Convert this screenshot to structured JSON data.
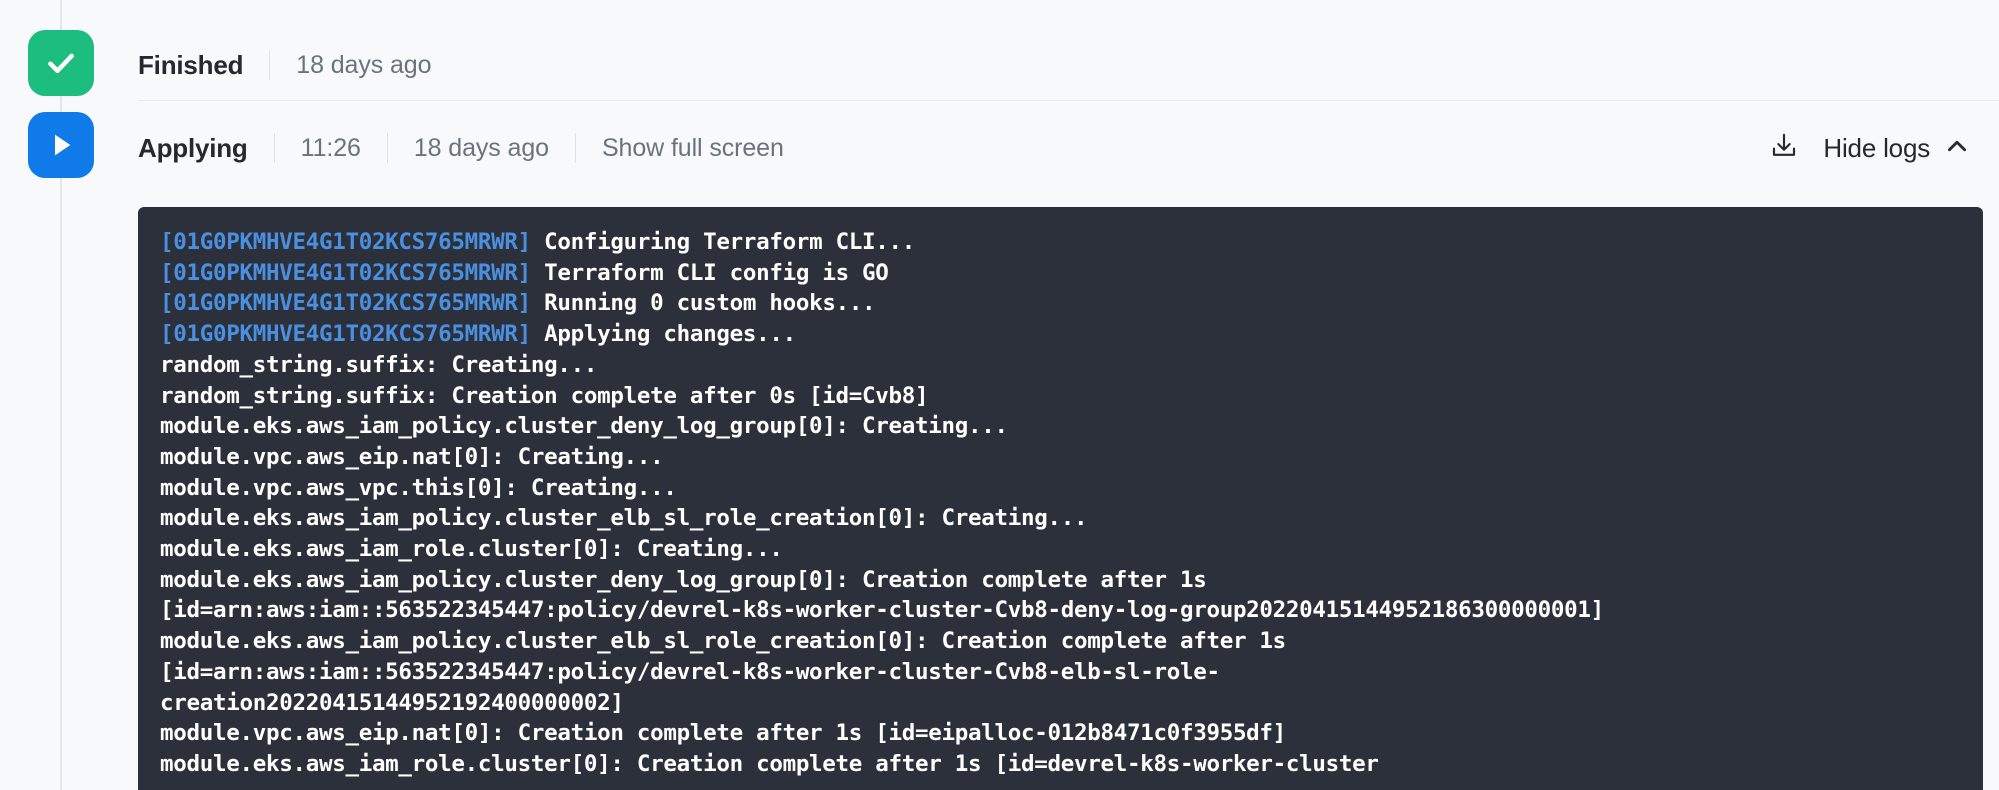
{
  "theme": {
    "page_bg": "#f7f9fa",
    "success_color": "#1cbd7f",
    "running_color": "#0f7ae8",
    "log_bg": "#2b303b",
    "log_text": "#ffffff",
    "log_id_color": "#4a8fe0",
    "muted_text": "#6a737d",
    "title_text": "#24292e"
  },
  "steps": [
    {
      "id": "finished",
      "status_icon": "check-icon",
      "title": "Finished",
      "time": null,
      "relative_time": "18 days ago"
    },
    {
      "id": "applying",
      "status_icon": "play-icon",
      "title": "Applying",
      "time": "11:26",
      "relative_time": "18 days ago",
      "full_screen_label": "Show full screen",
      "download_icon": "download-icon",
      "hide_logs_label": "Hide logs",
      "chevron_icon": "chevron-up-icon"
    }
  ],
  "log": {
    "run_id": "01G0PKMHVE4G1T02KCS765MRWR",
    "lines": [
      {
        "id": "01G0PKMHVE4G1T02KCS765MRWR",
        "text": " Configuring Terraform CLI..."
      },
      {
        "id": "01G0PKMHVE4G1T02KCS765MRWR",
        "text": " Terraform CLI config is GO"
      },
      {
        "id": "01G0PKMHVE4G1T02KCS765MRWR",
        "text": " Running 0 custom hooks..."
      },
      {
        "id": "01G0PKMHVE4G1T02KCS765MRWR",
        "text": " Applying changes..."
      },
      {
        "id": null,
        "text": "random_string.suffix: Creating..."
      },
      {
        "id": null,
        "text": "random_string.suffix: Creation complete after 0s [id=Cvb8]"
      },
      {
        "id": null,
        "text": "module.eks.aws_iam_policy.cluster_deny_log_group[0]: Creating..."
      },
      {
        "id": null,
        "text": "module.vpc.aws_eip.nat[0]: Creating..."
      },
      {
        "id": null,
        "text": "module.vpc.aws_vpc.this[0]: Creating..."
      },
      {
        "id": null,
        "text": "module.eks.aws_iam_policy.cluster_elb_sl_role_creation[0]: Creating..."
      },
      {
        "id": null,
        "text": "module.eks.aws_iam_role.cluster[0]: Creating..."
      },
      {
        "id": null,
        "text": "module.eks.aws_iam_policy.cluster_deny_log_group[0]: Creation complete after 1s"
      },
      {
        "id": null,
        "text": "[id=arn:aws:iam::563522345447:policy/devrel-k8s-worker-cluster-Cvb8-deny-log-group20220415144952186300000001]"
      },
      {
        "id": null,
        "text": "module.eks.aws_iam_policy.cluster_elb_sl_role_creation[0]: Creation complete after 1s"
      },
      {
        "id": null,
        "text": "[id=arn:aws:iam::563522345447:policy/devrel-k8s-worker-cluster-Cvb8-elb-sl-role-"
      },
      {
        "id": null,
        "text": "creation20220415144952192400000002]"
      },
      {
        "id": null,
        "text": "module.vpc.aws_eip.nat[0]: Creation complete after 1s [id=eipalloc-012b8471c0f3955df]"
      },
      {
        "id": null,
        "text": "module.eks.aws_iam_role.cluster[0]: Creation complete after 1s [id=devrel-k8s-worker-cluster"
      }
    ]
  }
}
